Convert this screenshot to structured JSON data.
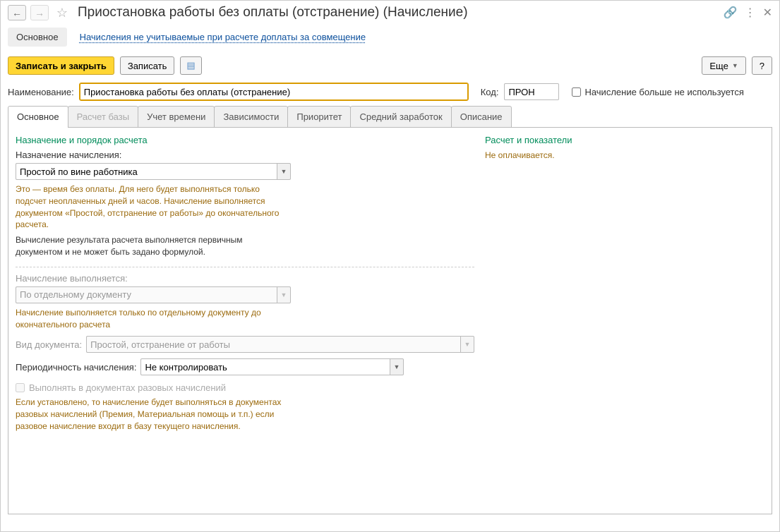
{
  "titlebar": {
    "title": "Приостановка работы без оплаты (отстранение) (Начисление)"
  },
  "subnav": {
    "main": "Основное",
    "link": "Начисления не учитываемые при расчете доплаты за совмещение"
  },
  "toolbar": {
    "save_close": "Записать и закрыть",
    "save": "Записать",
    "more": "Еще",
    "help": "?"
  },
  "header_form": {
    "name_label": "Наименование:",
    "name_value": "Приостановка работы без оплаты (отстранение)",
    "code_label": "Код:",
    "code_value": "ПРОН",
    "disabled_label": "Начисление больше не используется"
  },
  "tabs": {
    "t0": "Основное",
    "t1": "Расчет базы",
    "t2": "Учет времени",
    "t3": "Зависимости",
    "t4": "Приоритет",
    "t5": "Средний заработок",
    "t6": "Описание"
  },
  "left": {
    "section1_title": "Назначение и порядок расчета",
    "assign_label": "Назначение начисления:",
    "assign_value": "Простой по вине работника",
    "assign_hint1": "Это — время без оплаты. Для него будет выполняться только подсчет неоплаченных дней и часов. Начисление выполняется документом «Простой, отстранение от работы» до окончательного расчета.",
    "assign_hint2": "Вычисление результата расчета выполняется первичным документом и не может быть задано формулой.",
    "exec_label": "Начисление выполняется:",
    "exec_value": "По отдельному документу",
    "exec_hint": "Начисление выполняется только по отдельному документу до окончательного расчета",
    "doc_label": "Вид документа:",
    "doc_value": "Простой, отстранение от работы",
    "period_label": "Периодичность начисления:",
    "period_value": "Не контролировать",
    "onetime_cb": "Выполнять в документах разовых начислений",
    "onetime_hint": "Если установлено, то начисление будет выполняться в документах разовых начислений (Премия, Материальная помощь и т.п.) если разовое начисление входит в базу текущего начисления."
  },
  "right": {
    "section_title": "Расчет и показатели",
    "text": "Не оплачивается."
  }
}
